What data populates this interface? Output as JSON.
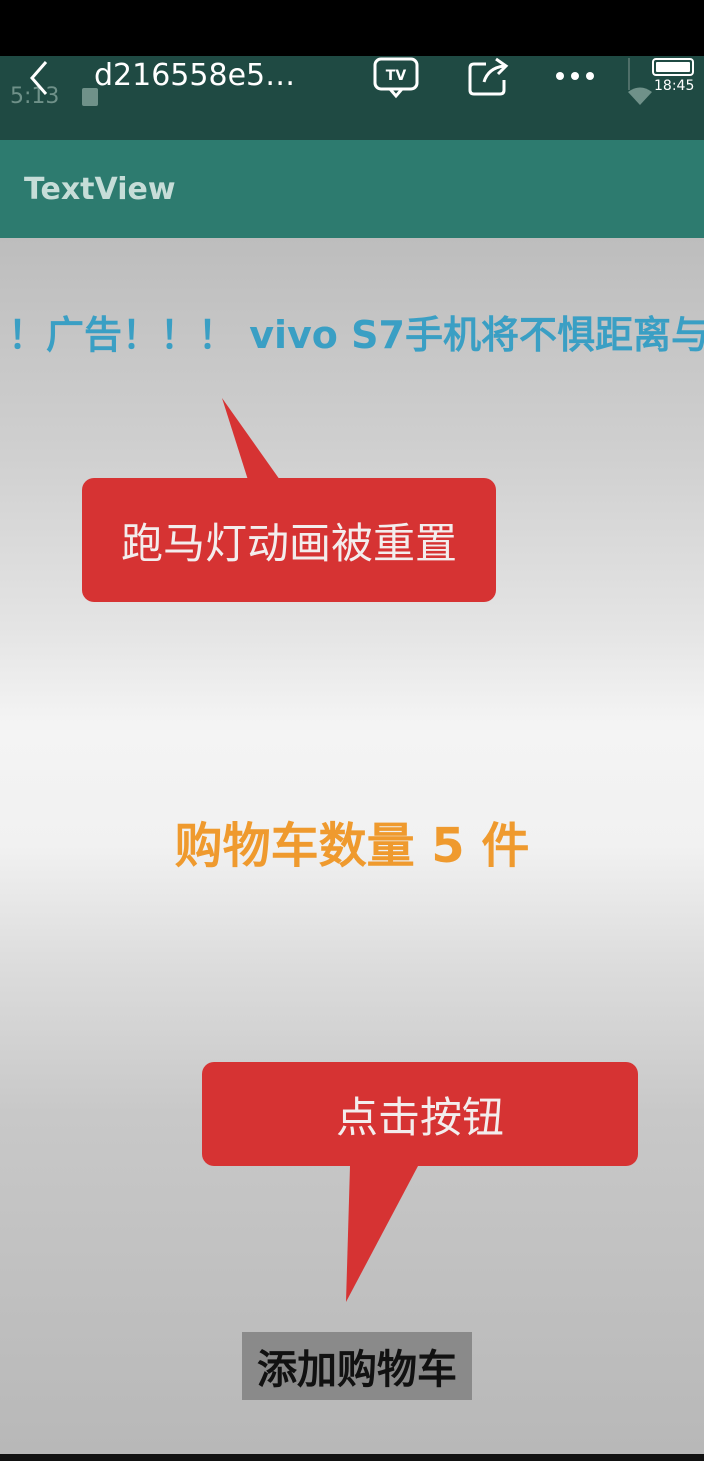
{
  "viewer": {
    "title": "d216558e5…",
    "status_time": "5:13",
    "battery_time": "18:45"
  },
  "app": {
    "toolbar_title": "TextView"
  },
  "content": {
    "marquee_text": "！广告！！！ vivo S7手机将不惧距离与",
    "callout_top": "跑马灯动画被重置",
    "cart_count": "购物车数量 5 件",
    "callout_bottom": "点击按钮",
    "add_cart_button": "添加购物车"
  },
  "colors": {
    "viewer_bar": "#1f4a43",
    "app_toolbar": "#2d7b6f",
    "marquee_text": "#3a9fc4",
    "callout": "#d63333",
    "cart_count_text": "#ef9a2e",
    "button_bg": "#8a8a8a"
  }
}
